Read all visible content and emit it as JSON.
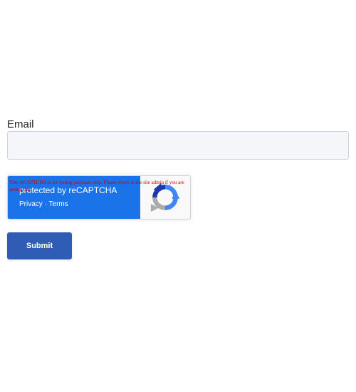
{
  "form": {
    "email_label": "Email",
    "email_value": "",
    "email_placeholder": "",
    "submit_label": "Submit"
  },
  "recaptcha": {
    "protected_text": "protected by reCAPTCHA",
    "privacy_link": "Privacy",
    "separator": "·",
    "terms_link": "Terms",
    "warning_text": "This reCAPTCHA is for testing purposes only. Please report to the site admin if you are seeing this.",
    "logo_icon": "recaptcha-logo-icon"
  },
  "colors": {
    "recaptcha_blue": "#1a73e8",
    "submit_bg": "#2f5db5",
    "warning_red": "#cc0000",
    "input_bg": "#f4f6f9"
  }
}
